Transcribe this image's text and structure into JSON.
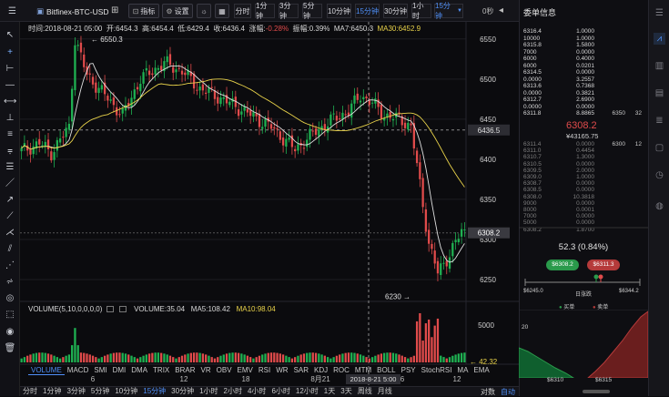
{
  "toolbar": {
    "symbol": "Bitfinex-BTC-USD",
    "indicator_label": "指标",
    "settings_label": "设置",
    "periods": [
      "分时",
      "1分钟",
      "3分钟",
      "5分钟",
      "10分钟",
      "15分钟",
      "30分钟",
      "1小时",
      "15分钟"
    ],
    "countdown": "0秒"
  },
  "info": {
    "time": "时间:2018-08-21 05:00",
    "open": "开:6454.3",
    "high": "高:6454.4",
    "low": "低:6429.4",
    "close": "收:6436.4",
    "change_label": "涨幅:",
    "change": "-0.28%",
    "amplitude": "振幅:0.39%",
    "ma7": "MA7:6450.3",
    "ma30": "MA30:6452.9"
  },
  "chart_data": {
    "type": "candlestick",
    "price_axis_ticks": [
      "6550",
      "6500",
      "6450",
      "6400",
      "6350",
      "6300",
      "6250"
    ],
    "high_marker": "6550.3",
    "low_marker": "6230",
    "crosshair_price": "6436.5",
    "last_price_tag": "6308.2",
    "ylim": [
      6225,
      6560
    ],
    "volume_axis_ticks": [
      "5000"
    ],
    "volume_tag": "42.32",
    "x_tick_labels": [
      "6",
      "12",
      "18",
      "8月21",
      "6",
      "12"
    ],
    "crosshair_time": "2018-8-21 5:00",
    "colors": {
      "up": "#1fb152",
      "down": "#e04b4b",
      "ma7": "#e0e0e0",
      "ma30": "#e8d24a"
    }
  },
  "volume": {
    "label": "VOLUME(5,10,0,0,0,0)",
    "value": "VOLUME:35.04",
    "ma5": "MA5:108.42",
    "ma10": "MA10:98.04"
  },
  "indicator_tabs": [
    "VOLUME",
    "MACD",
    "SMI",
    "DMI",
    "DMA",
    "TRIX",
    "BRAR",
    "VR",
    "OBV",
    "EMV",
    "RSI",
    "WR",
    "SAR",
    "KDJ",
    "ROC",
    "MTM",
    "BOLL",
    "PSY",
    "StochRSI",
    "MA",
    "EMA"
  ],
  "bottom_periods": [
    "分时",
    "1分钟",
    "3分钟",
    "5分钟",
    "10分钟",
    "15分钟",
    "30分钟",
    "1小时",
    "2小时",
    "4小时",
    "6小时",
    "12小时",
    "1天",
    "3天",
    "周线",
    "月线"
  ],
  "bottom_right": {
    "contracts": "对数",
    "auto": "自动"
  },
  "order_book": {
    "title": "委单信息",
    "asks": [
      [
        "6316.4",
        "1.0000"
      ],
      [
        "10000",
        "1.0000"
      ],
      [
        "6315.8",
        "1.5800"
      ],
      [
        "7000",
        "0.0000"
      ],
      [
        "6000",
        "0.4000"
      ],
      [
        "6000",
        "0.0201"
      ],
      [
        "6314.5",
        "0.0000"
      ],
      [
        "0.0000",
        "3.2557"
      ],
      [
        "6313.6",
        "0.7368"
      ],
      [
        "0.0000",
        "0.3821"
      ],
      [
        "6312.7",
        "2.6900"
      ],
      [
        "0.0000",
        "0.0000"
      ],
      [
        "6311.8",
        "8.8865"
      ]
    ],
    "ask_extra": [
      "6350",
      "32"
    ],
    "last_price": "6308.2",
    "last_cny": "¥43165.75",
    "bids": [
      [
        "6311.4",
        "0.0000"
      ],
      [
        "6311.0",
        "0.4454"
      ],
      [
        "6310.7",
        "1.3000"
      ],
      [
        "6310.5",
        "0.0000"
      ],
      [
        "6309.5",
        "2.0000"
      ],
      [
        "6309.0",
        "1.0000"
      ],
      [
        "6308.7",
        "0.0000"
      ],
      [
        "6308.5",
        "0.0000"
      ],
      [
        "6308.0",
        "10.3818"
      ],
      [
        "9000",
        "0.0000"
      ],
      [
        "8000",
        "0.0001"
      ],
      [
        "7000",
        "0.0000"
      ],
      [
        "5000",
        "0.0000"
      ],
      [
        "6308.2",
        "1.8700"
      ]
    ],
    "bid_extra": [
      "6300",
      "12"
    ],
    "sentiment": "52.3 (0.84%)",
    "buy_button": "$6308.2",
    "sell_button": "$6311.3",
    "range_low": "$6245.0",
    "range_label": "日涨跌",
    "range_high": "$6344.2",
    "legend_buy": "买单",
    "legend_sell": "卖单",
    "depth_y": "20",
    "depth_x": [
      "$6310",
      "$6315"
    ]
  }
}
